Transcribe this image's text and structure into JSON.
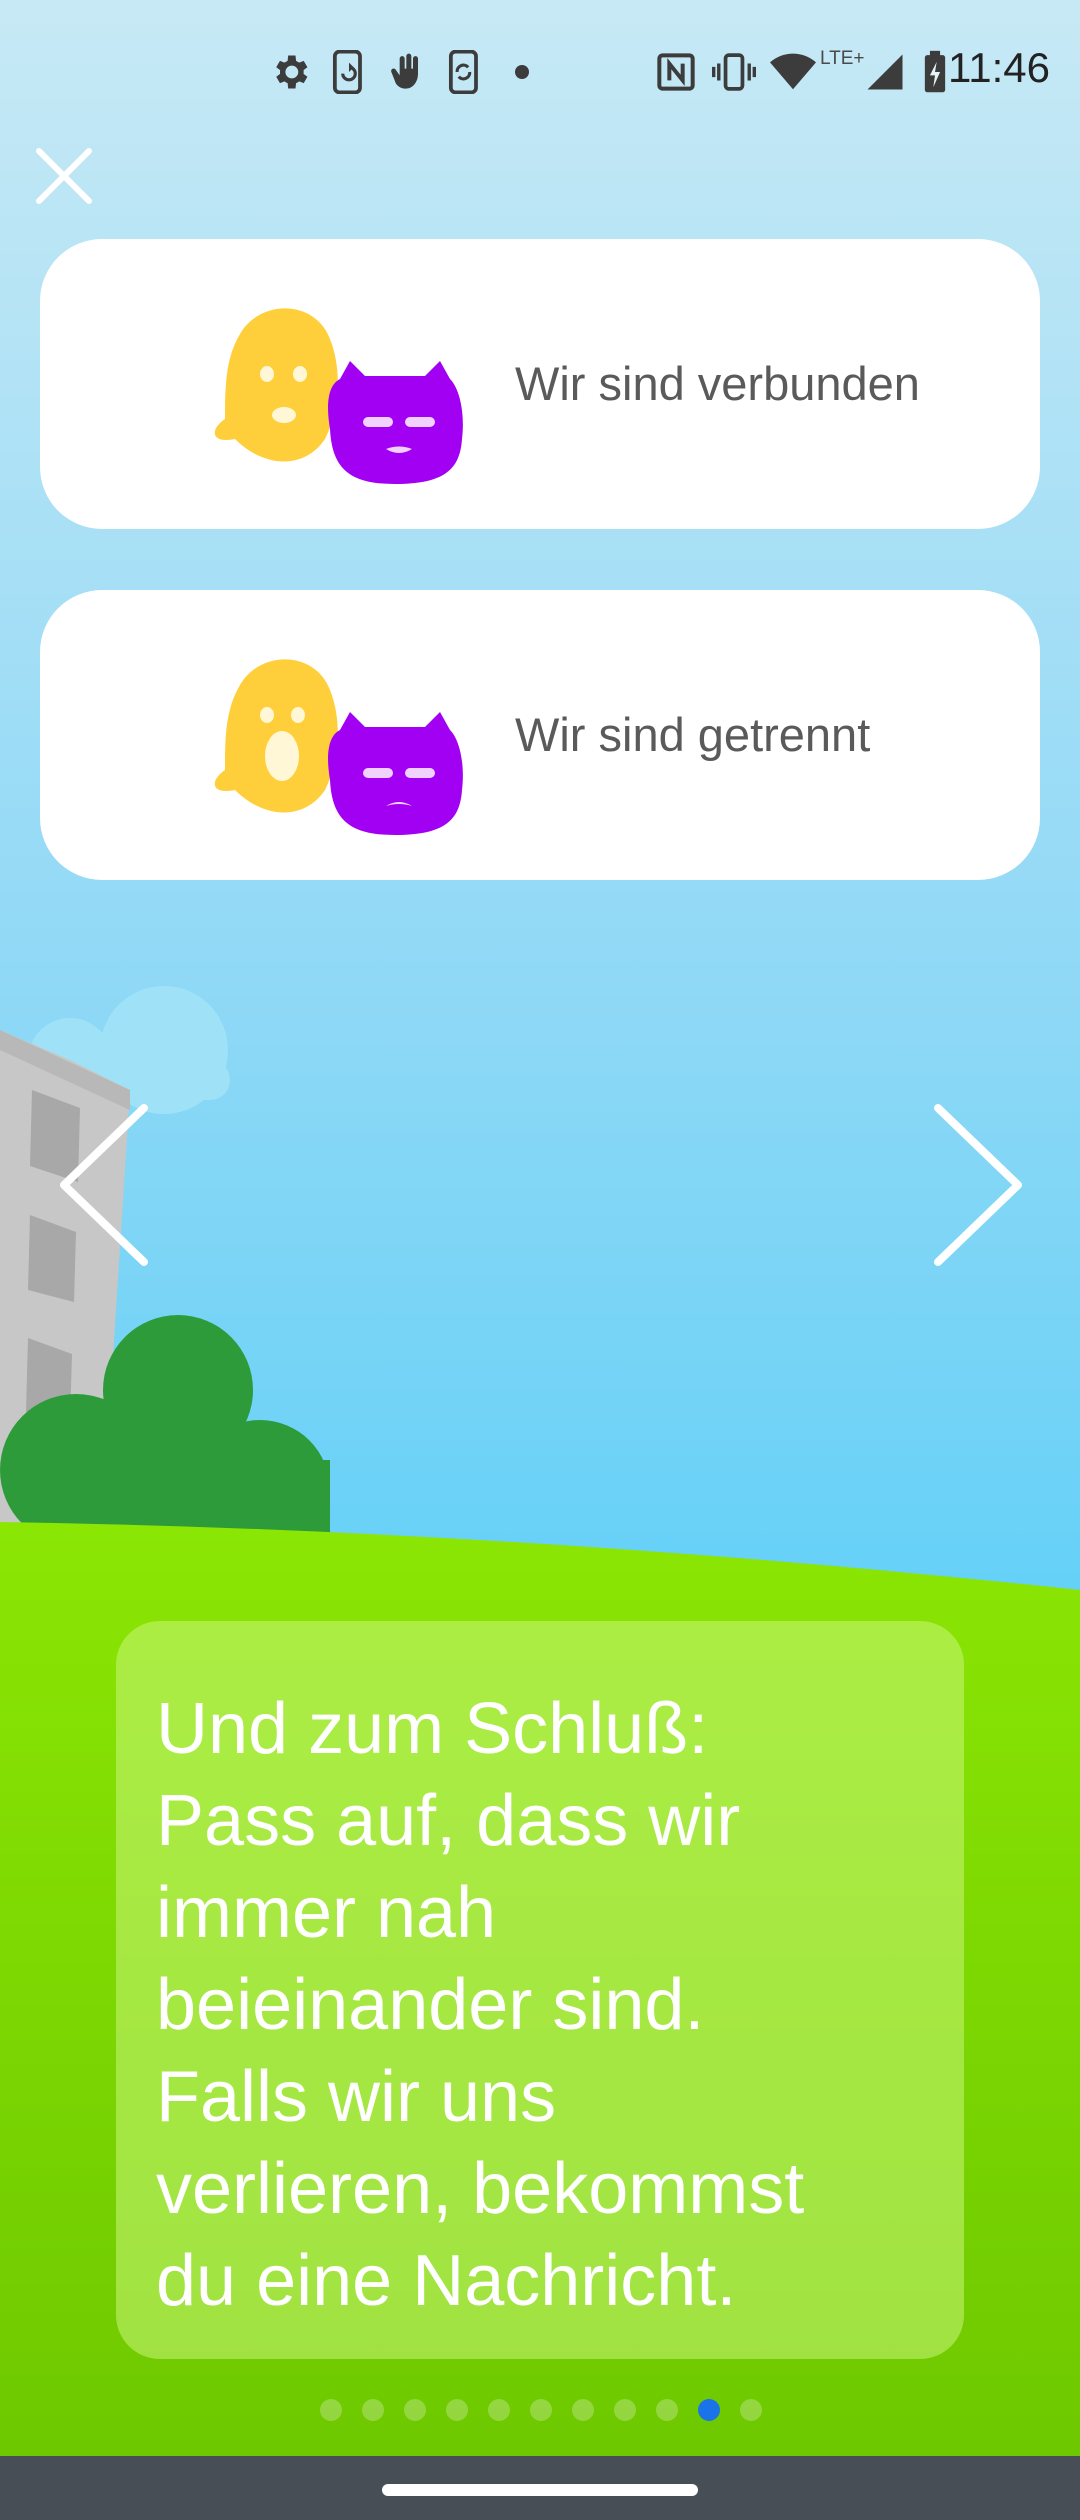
{
  "status_bar": {
    "time": "11:46",
    "network_label": "LTE+",
    "left_icons": [
      "settings-icon",
      "screen-rotate-icon",
      "hand-gesture-icon",
      "screen-sync-icon",
      "dot-icon"
    ],
    "right_icons": [
      "nfc-icon",
      "vibrate-icon",
      "wifi-icon",
      "cell-signal-icon",
      "battery-charging-icon"
    ]
  },
  "top_bar": {
    "close_icon": "close-icon"
  },
  "cards": [
    {
      "label": "Wir sind verbunden",
      "mood": "happy"
    },
    {
      "label": "Wir sind getrennt",
      "mood": "surprised"
    }
  ],
  "navigation": {
    "prev_icon": "chevron-left-icon",
    "next_icon": "chevron-right-icon"
  },
  "bubble": {
    "text": "Und zum Schluß:\nPass auf, dass wir\nimmer nah\nbeieinander sind.\nFalls wir uns\nverlieren, bekommst\ndu eine Nachricht."
  },
  "pagination": {
    "total": 11,
    "current": 10
  },
  "colors": {
    "ghost": "#ffcf3b",
    "cat": "#a200f2",
    "active_dot": "#1a73e8",
    "grass": "#7ed100",
    "bush": "#2e9b3a"
  }
}
